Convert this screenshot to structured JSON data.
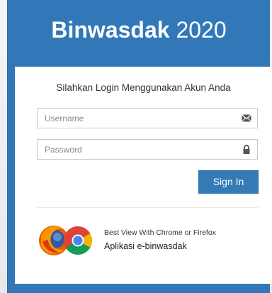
{
  "header": {
    "title_bold": "Binwasdak",
    "title_year": "2020"
  },
  "login": {
    "subtitle": "Silahkan Login Menggunakan Akun Anda",
    "username": {
      "placeholder": "Username",
      "value": "",
      "icon": "envelope-icon"
    },
    "password": {
      "placeholder": "Password",
      "value": "",
      "icon": "lock-icon"
    },
    "signin_label": "Sign In"
  },
  "footer": {
    "browser_icons": [
      "firefox-logo",
      "chrome-logo"
    ],
    "best_view": "Best View With Chrome or Firefox",
    "app_name": "Aplikasi e-binwasdak"
  },
  "colors": {
    "panel": "#3278b8",
    "button": "#337ab7",
    "card": "#ffffff"
  }
}
